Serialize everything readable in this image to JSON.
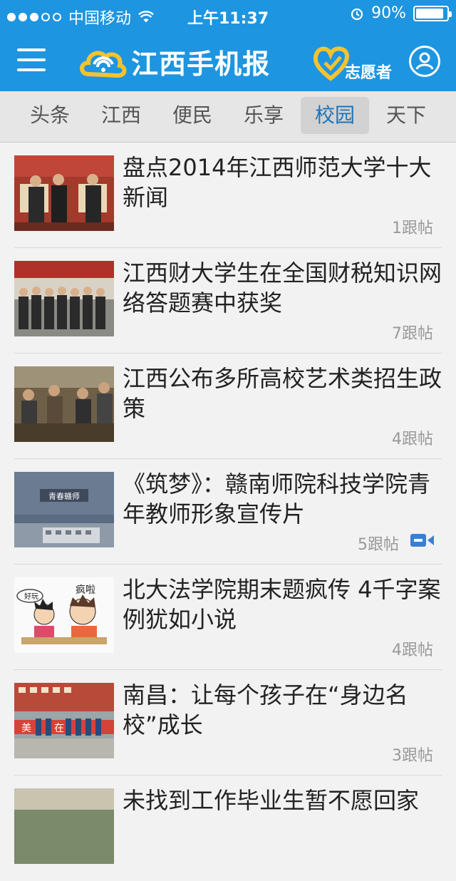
{
  "status": {
    "carrier": "中国移动",
    "time": "上午11:37",
    "battery": "90%",
    "battery_level": 0.9,
    "signal_filled": 3,
    "signal_total": 5
  },
  "header": {
    "logo_text": "江西手机报",
    "volunteer_label": "志愿者"
  },
  "tabs": [
    {
      "label": "头条"
    },
    {
      "label": "江西"
    },
    {
      "label": "便民"
    },
    {
      "label": "乐享"
    },
    {
      "label": "校园"
    },
    {
      "label": "天下"
    }
  ],
  "active_tab": "校园",
  "news": [
    {
      "title": "盘点2014年江西师范大学十大新闻",
      "replies": "1跟帖",
      "video": false
    },
    {
      "title": "江西财大学生在全国财税知识网络答题赛中获奖",
      "replies": "7跟帖",
      "video": false
    },
    {
      "title": "江西公布多所高校艺术类招生政策",
      "replies": "4跟帖",
      "video": false
    },
    {
      "title": "《筑梦》：赣南师院科技学院青年教师形象宣传片",
      "replies": "5跟帖",
      "video": true
    },
    {
      "title": "北大法学院期末题疯传 4千字案例犹如小说",
      "replies": "4跟帖",
      "video": false
    },
    {
      "title": "南昌：让每个孩子在“身边名校”成长",
      "replies": "3跟帖",
      "video": false
    },
    {
      "title": "未找到工作毕业生暂不愿回家",
      "replies": "",
      "video": false
    }
  ],
  "thumb_captions": {
    "item4": "青春赣师",
    "item5_a": "疯啦",
    "item5_b": "好玩",
    "item6_a": "美",
    "item6_b": "在"
  },
  "colors": {
    "brand": "#1e95e0",
    "active_tab_text": "#1e73b8",
    "video_icon": "#3a7fd5"
  }
}
